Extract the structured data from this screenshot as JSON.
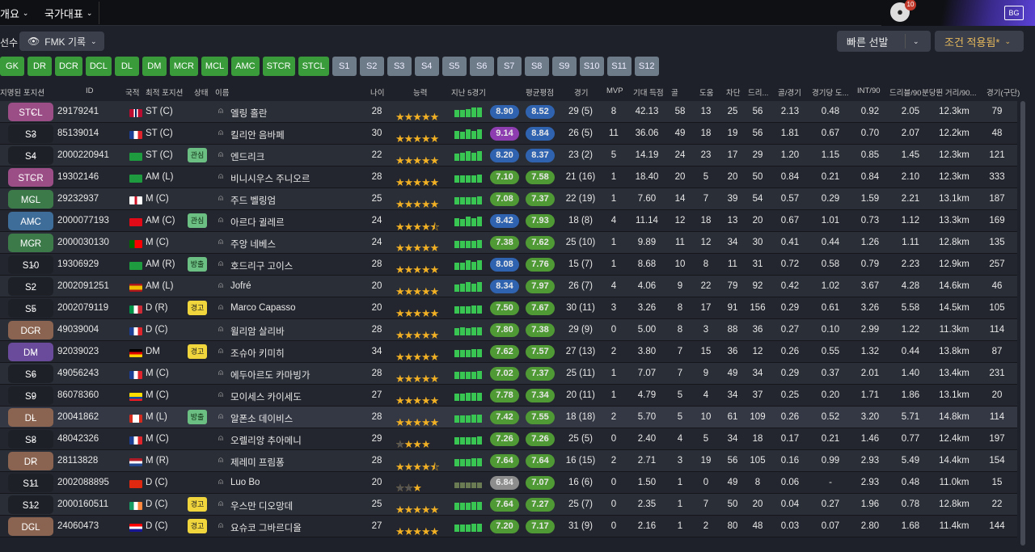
{
  "nav": {
    "tab1": "개요",
    "tab2": "국가대표",
    "notification_count": "10",
    "logo_text": "BG"
  },
  "toolbar": {
    "label": "선수",
    "view": "FMK 기록",
    "quick_select": "빠른 선발",
    "filter": "조건 적용됨*"
  },
  "positions": [
    "GK",
    "DR",
    "DCR",
    "DCL",
    "DL",
    "DM",
    "MCR",
    "MCL",
    "AMC",
    "STCR",
    "STCL",
    "S1",
    "S2",
    "S3",
    "S4",
    "S5",
    "S6",
    "S7",
    "S8",
    "S9",
    "S10",
    "S11",
    "S12"
  ],
  "columns": {
    "assigned": "지명된 포지션",
    "id": "ID",
    "nation": "국적",
    "best_pos": "최적 포지션",
    "status": "상태",
    "name": "이름",
    "age": "나이",
    "ability": "능력",
    "last5": "지난 5경기",
    "avg": "평균평점",
    "apps": "경기",
    "mvp": "MVP",
    "xg": "기대 득점",
    "goals": "골",
    "assists": "도움",
    "blocks": "차단",
    "dribbles": "드리...",
    "gpg": "골/경기",
    "apg": "경기당 도...",
    "int90": "INT/90",
    "drb90": "드리블/90",
    "dist90": "분당뛴 거리/90...",
    "club": "경기(구단)"
  },
  "colors": {
    "green_chip": "#3a9b3a",
    "slot_chip": "#6e7b88",
    "star": "#f2b124"
  },
  "players": [
    {
      "slot": "STCL",
      "id": "29179241",
      "flag": "NOR",
      "pos": "ST (C)",
      "tag": "",
      "name": "엘링 홀란",
      "age": "28",
      "stars": 5,
      "form": [
        3,
        3,
        4,
        5,
        5
      ],
      "last": "8.90",
      "avg": "8.52",
      "apps": "29 (5)",
      "mvp": "8",
      "xg": "42.13",
      "g": "58",
      "a": "13",
      "blk": "25",
      "drb": "56",
      "gpg": "2.13",
      "apg": "0.48",
      "int": "0.92",
      "drb90": "2.05",
      "dist": "12.3km",
      "club": "79"
    },
    {
      "slot": "S3",
      "id": "85139014",
      "flag": "FRA",
      "pos": "ST (C)",
      "tag": "",
      "name": "킬리안 음바페",
      "age": "30",
      "stars": 5,
      "form": [
        4,
        3,
        5,
        4,
        5
      ],
      "last": "9.14",
      "avg": "8.84",
      "apps": "26 (5)",
      "mvp": "11",
      "xg": "36.06",
      "g": "49",
      "a": "18",
      "blk": "19",
      "drb": "56",
      "gpg": "1.81",
      "apg": "0.67",
      "int": "0.70",
      "drb90": "2.07",
      "dist": "12.2km",
      "club": "48"
    },
    {
      "slot": "S4",
      "id": "2000220941",
      "flag": "BRA",
      "pos": "ST (C)",
      "tag": "관심",
      "name": "엔드리크",
      "age": "22",
      "stars": 5,
      "form": [
        3,
        4,
        5,
        4,
        5
      ],
      "last": "8.20",
      "avg": "8.37",
      "apps": "23 (2)",
      "mvp": "5",
      "xg": "14.19",
      "g": "24",
      "a": "23",
      "blk": "17",
      "drb": "29",
      "gpg": "1.20",
      "apg": "1.15",
      "int": "0.85",
      "drb90": "1.45",
      "dist": "12.3km",
      "club": "121"
    },
    {
      "slot": "STCR",
      "id": "19302146",
      "flag": "BRA",
      "pos": "AM (L)",
      "tag": "",
      "name": "비니시우스 주니오르",
      "age": "28",
      "stars": 5,
      "form": [
        3,
        3,
        3,
        3,
        4
      ],
      "last": "7.10",
      "avg": "7.58",
      "apps": "21 (16)",
      "mvp": "1",
      "xg": "18.40",
      "g": "20",
      "a": "5",
      "blk": "20",
      "drb": "50",
      "gpg": "0.84",
      "apg": "0.21",
      "int": "0.84",
      "drb90": "2.10",
      "dist": "12.3km",
      "club": "333"
    },
    {
      "slot": "MCL",
      "id": "29232937",
      "flag": "ENG",
      "pos": "M (C)",
      "tag": "",
      "name": "주드 벨링엄",
      "age": "25",
      "stars": 5,
      "form": [
        3,
        3,
        3,
        3,
        4
      ],
      "last": "7.08",
      "avg": "7.37",
      "apps": "22 (19)",
      "mvp": "1",
      "xg": "7.60",
      "g": "14",
      "a": "7",
      "blk": "39",
      "drb": "54",
      "gpg": "0.57",
      "apg": "0.29",
      "int": "1.59",
      "drb90": "2.21",
      "dist": "13.1km",
      "club": "187"
    },
    {
      "slot": "AMC",
      "id": "2000077193",
      "flag": "TUR",
      "pos": "AM (C)",
      "tag": "관심",
      "name": "아르다 귈레르",
      "age": "24",
      "stars": 4.5,
      "form": [
        4,
        3,
        5,
        4,
        5
      ],
      "last": "8.42",
      "avg": "7.93",
      "apps": "18 (8)",
      "mvp": "4",
      "xg": "11.14",
      "g": "12",
      "a": "18",
      "blk": "13",
      "drb": "20",
      "gpg": "0.67",
      "apg": "1.01",
      "int": "0.73",
      "drb90": "1.12",
      "dist": "13.3km",
      "club": "169"
    },
    {
      "slot": "MCR",
      "id": "2000030130",
      "flag": "POR",
      "pos": "M (C)",
      "tag": "",
      "name": "주앙 네베스",
      "age": "24",
      "stars": 5,
      "form": [
        3,
        3,
        3,
        3,
        4
      ],
      "last": "7.38",
      "avg": "7.62",
      "apps": "25 (10)",
      "mvp": "1",
      "xg": "9.89",
      "g": "11",
      "a": "12",
      "blk": "34",
      "drb": "30",
      "gpg": "0.41",
      "apg": "0.44",
      "int": "1.26",
      "drb90": "1.11",
      "dist": "12.8km",
      "club": "135"
    },
    {
      "slot": "S10",
      "id": "19306929",
      "flag": "BRA",
      "pos": "AM (R)",
      "tag": "방출",
      "name": "호드리구 고이스",
      "age": "28",
      "stars": 5,
      "form": [
        3,
        3,
        5,
        4,
        5
      ],
      "last": "8.08",
      "avg": "7.76",
      "apps": "15 (7)",
      "mvp": "1",
      "xg": "8.68",
      "g": "10",
      "a": "8",
      "blk": "11",
      "drb": "31",
      "gpg": "0.72",
      "apg": "0.58",
      "int": "0.79",
      "drb90": "2.23",
      "dist": "12.9km",
      "club": "257"
    },
    {
      "slot": "S2",
      "id": "2002091251",
      "flag": "ESP",
      "pos": "AM (L)",
      "tag": "",
      "name": "Jofré",
      "age": "20",
      "stars": 5,
      "form": [
        3,
        4,
        5,
        4,
        5
      ],
      "last": "8.34",
      "avg": "7.97",
      "apps": "26 (7)",
      "mvp": "4",
      "xg": "4.06",
      "g": "9",
      "a": "22",
      "blk": "79",
      "drb": "92",
      "gpg": "0.42",
      "apg": "1.02",
      "int": "3.67",
      "drb90": "4.28",
      "dist": "14.6km",
      "club": "46"
    },
    {
      "slot": "S5",
      "id": "2002079119",
      "flag": "ITA",
      "pos": "D (R)",
      "tag": "경고",
      "name": "Marco Capasso",
      "age": "20",
      "stars": 5,
      "form": [
        3,
        3,
        3,
        4,
        4
      ],
      "last": "7.50",
      "avg": "7.67",
      "apps": "30 (11)",
      "mvp": "3",
      "xg": "3.26",
      "g": "8",
      "a": "17",
      "blk": "91",
      "drb": "156",
      "gpg": "0.29",
      "apg": "0.61",
      "int": "3.26",
      "drb90": "5.58",
      "dist": "14.5km",
      "club": "105"
    },
    {
      "slot": "DCR",
      "id": "49039004",
      "flag": "FRA",
      "pos": "D (C)",
      "tag": "",
      "name": "윌리암 살리바",
      "age": "28",
      "stars": 5,
      "form": [
        3,
        4,
        3,
        4,
        4
      ],
      "last": "7.80",
      "avg": "7.38",
      "apps": "29 (9)",
      "mvp": "0",
      "xg": "5.00",
      "g": "8",
      "a": "3",
      "blk": "88",
      "drb": "36",
      "gpg": "0.27",
      "apg": "0.10",
      "int": "2.99",
      "drb90": "1.22",
      "dist": "11.3km",
      "club": "114"
    },
    {
      "slot": "DM",
      "id": "92039023",
      "flag": "GER",
      "pos": "DM",
      "tag": "경고",
      "name": "조슈아 키미히",
      "age": "34",
      "stars": 5,
      "form": [
        3,
        3,
        3,
        4,
        4
      ],
      "last": "7.62",
      "avg": "7.57",
      "apps": "27 (13)",
      "mvp": "2",
      "xg": "3.80",
      "g": "7",
      "a": "15",
      "blk": "36",
      "drb": "12",
      "gpg": "0.26",
      "apg": "0.55",
      "int": "1.32",
      "drb90": "0.44",
      "dist": "13.8km",
      "club": "87"
    },
    {
      "slot": "S6",
      "id": "49056243",
      "flag": "FRA",
      "pos": "M (C)",
      "tag": "",
      "name": "에두아르도 카마빙가",
      "age": "28",
      "stars": 5,
      "form": [
        3,
        3,
        3,
        3,
        4
      ],
      "last": "7.02",
      "avg": "7.37",
      "apps": "25 (11)",
      "mvp": "1",
      "xg": "7.07",
      "g": "7",
      "a": "9",
      "blk": "49",
      "drb": "34",
      "gpg": "0.29",
      "apg": "0.37",
      "int": "2.01",
      "drb90": "1.40",
      "dist": "13.4km",
      "club": "231"
    },
    {
      "slot": "S9",
      "id": "86078360",
      "flag": "ECU",
      "pos": "M (C)",
      "tag": "",
      "name": "모이세스 카이세도",
      "age": "27",
      "stars": 5,
      "form": [
        3,
        3,
        4,
        4,
        4
      ],
      "last": "7.78",
      "avg": "7.34",
      "apps": "20 (11)",
      "mvp": "1",
      "xg": "4.79",
      "g": "5",
      "a": "4",
      "blk": "34",
      "drb": "37",
      "gpg": "0.25",
      "apg": "0.20",
      "int": "1.71",
      "drb90": "1.86",
      "dist": "13.1km",
      "club": "20"
    },
    {
      "slot": "DL",
      "id": "20041862",
      "flag": "CAN",
      "pos": "M (L)",
      "tag": "방출",
      "name": "알폰소 데이비스",
      "age": "28",
      "stars": 5,
      "form": [
        3,
        3,
        3,
        4,
        4
      ],
      "last": "7.42",
      "avg": "7.55",
      "apps": "18 (18)",
      "mvp": "2",
      "xg": "5.70",
      "g": "5",
      "a": "10",
      "blk": "61",
      "drb": "109",
      "gpg": "0.26",
      "apg": "0.52",
      "int": "3.20",
      "drb90": "5.71",
      "dist": "14.8km",
      "club": "114"
    },
    {
      "slot": "S8",
      "id": "48042326",
      "flag": "FRA",
      "pos": "M (C)",
      "tag": "",
      "name": "오렐리앙 추아메니",
      "age": "29",
      "stars": 4,
      "form": [
        3,
        3,
        3,
        3,
        4
      ],
      "last": "7.26",
      "avg": "7.26",
      "apps": "25 (5)",
      "mvp": "0",
      "xg": "2.40",
      "g": "4",
      "a": "5",
      "blk": "34",
      "drb": "18",
      "gpg": "0.17",
      "apg": "0.21",
      "int": "1.46",
      "drb90": "0.77",
      "dist": "12.4km",
      "club": "197"
    },
    {
      "slot": "DR",
      "id": "28113828",
      "flag": "NED",
      "pos": "M (R)",
      "tag": "",
      "name": "제레미 프림퐁",
      "age": "28",
      "stars": 4.5,
      "form": [
        3,
        3,
        3,
        4,
        4
      ],
      "last": "7.64",
      "avg": "7.64",
      "apps": "16 (15)",
      "mvp": "2",
      "xg": "2.71",
      "g": "3",
      "a": "19",
      "blk": "56",
      "drb": "105",
      "gpg": "0.16",
      "apg": "0.99",
      "int": "2.93",
      "drb90": "5.49",
      "dist": "14.4km",
      "club": "154"
    },
    {
      "slot": "S11",
      "id": "2002088895",
      "flag": "CHN",
      "pos": "D (C)",
      "tag": "",
      "name": "Luo Bo",
      "age": "20",
      "stars": 3,
      "form": [
        2,
        2,
        2,
        2,
        2
      ],
      "last": "6.84",
      "avg": "7.07",
      "apps": "16 (6)",
      "mvp": "0",
      "xg": "1.50",
      "g": "1",
      "a": "0",
      "blk": "49",
      "drb": "8",
      "gpg": "0.06",
      "apg": "-",
      "int": "2.93",
      "drb90": "0.48",
      "dist": "11.0km",
      "club": "15"
    },
    {
      "slot": "S12",
      "id": "2000160511",
      "flag": "IRL",
      "pos": "D (C)",
      "tag": "경고",
      "name": "우스만 디오망데",
      "age": "25",
      "stars": 5,
      "form": [
        3,
        3,
        3,
        4,
        4
      ],
      "last": "7.64",
      "avg": "7.27",
      "apps": "25 (7)",
      "mvp": "0",
      "xg": "2.35",
      "g": "1",
      "a": "7",
      "blk": "50",
      "drb": "20",
      "gpg": "0.04",
      "apg": "0.27",
      "int": "1.96",
      "drb90": "0.78",
      "dist": "12.8km",
      "club": "22"
    },
    {
      "slot": "DCL",
      "id": "24060473",
      "flag": "CRO",
      "pos": "D (C)",
      "tag": "경고",
      "name": "요슈코 그바르디올",
      "age": "27",
      "stars": 5,
      "form": [
        3,
        3,
        3,
        4,
        4
      ],
      "last": "7.20",
      "avg": "7.17",
      "apps": "31 (9)",
      "mvp": "0",
      "xg": "2.16",
      "g": "1",
      "a": "2",
      "blk": "80",
      "drb": "48",
      "gpg": "0.03",
      "apg": "0.07",
      "int": "2.80",
      "drb90": "1.68",
      "dist": "11.4km",
      "club": "144"
    }
  ]
}
